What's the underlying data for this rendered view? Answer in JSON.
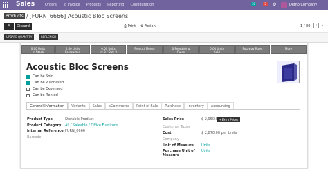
{
  "app": {
    "name": "Sales"
  },
  "menu": [
    "Orders",
    "To Invoice",
    "Products",
    "Reporting",
    "Configuration"
  ],
  "user": {
    "name": "Demo Company",
    "badge1": "30",
    "badge2": "5"
  },
  "breadcrumb": {
    "root": "Products",
    "record": "[FURN_6666] Acoustic Bloc Screens"
  },
  "buttons": {
    "save": "A",
    "discard": "Discard",
    "print": "Print",
    "action": "Action"
  },
  "pager": {
    "label": "1 / 80"
  },
  "statusbar": {
    "update_qty": "UPDATE QUANTITY",
    "replenish": "REPLENISH"
  },
  "smart_buttons": [
    {
      "label": "0.00 Units",
      "sub": "In Stock"
    },
    {
      "label": "0.00 Units",
      "sub": "Forecasted"
    },
    {
      "label": "0.00 Units",
      "sub": "In: 0 / Out: 0"
    },
    {
      "label": "Product Moves",
      "sub": ""
    },
    {
      "label": "0 Reordering",
      "sub": "Rules"
    },
    {
      "label": "0.00 Units",
      "sub": "Sold"
    },
    {
      "label": "Putaway Rules",
      "sub": ""
    },
    {
      "label": "More",
      "sub": ""
    }
  ],
  "product": {
    "name": "Acoustic Bloc Screens"
  },
  "flags": [
    {
      "label": "Can be Sold",
      "checked": true
    },
    {
      "label": "Can be Purchased",
      "checked": true
    },
    {
      "label": "Can be Expensed",
      "checked": false
    },
    {
      "label": "Can be Rented",
      "checked": false
    }
  ],
  "tabs": [
    "General Information",
    "Variants",
    "Sales",
    "eCommerce",
    "Point of Sale",
    "Purchase",
    "Inventory",
    "Accounting"
  ],
  "left_fields": [
    {
      "label": "Product Type",
      "value": "Storable Product"
    },
    {
      "label": "Product Category",
      "value": "All / Saleable / Office Furniture"
    },
    {
      "label": "Internal Reference",
      "value": "FURN_6666"
    },
    {
      "label": "Barcode",
      "value": ""
    }
  ],
  "right_fields": {
    "sales_price_label": "Sales Price",
    "sales_price": "$ 2,950.00",
    "extra_prices": "Extra Prices",
    "customer_taxes": "Customer Taxes",
    "cost_label": "Cost",
    "cost": "$ 2,870.00 per Units",
    "company": "Company",
    "uom_label": "Unit of Measure",
    "uom": "Units",
    "puom_label": "Purchase Unit of Measure",
    "puom": "Units"
  },
  "colors": {
    "topbar": "#71639e",
    "accent": "#00a09d"
  }
}
